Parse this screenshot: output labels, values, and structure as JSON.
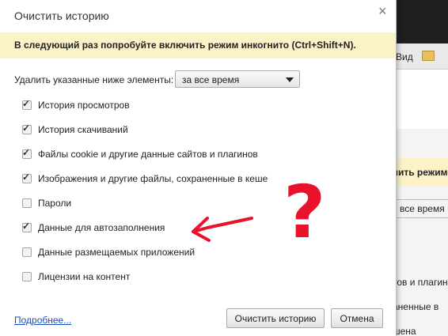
{
  "background": {
    "bookmark_text": "Вид",
    "hint_fragment": "чить режим",
    "select_fragment": "все время",
    "line1": "тов и плагин",
    "line2": "аненные в",
    "line3": "шена"
  },
  "dialog": {
    "title": "Очистить историю",
    "close_icon": "×",
    "hint": "В следующий раз попробуйте включить режим инкогнито (Ctrl+Shift+N).",
    "range_label": "Удалить указанные ниже элементы:",
    "range_value": "за все время",
    "options": [
      {
        "label": "История просмотров",
        "checked": true
      },
      {
        "label": "История скачиваний",
        "checked": true
      },
      {
        "label": "Файлы cookie и другие данные сайтов и плагинов",
        "checked": true
      },
      {
        "label": "Изображения и другие файлы, сохраненные в кеше",
        "checked": true
      },
      {
        "label": "Пароли",
        "checked": false
      },
      {
        "label": "Данные для автозаполнения",
        "checked": true
      },
      {
        "label": "Данные размещаемых приложений",
        "checked": false
      },
      {
        "label": "Лицензии на контент",
        "checked": false
      }
    ],
    "more_link": "Подробнее...",
    "clear_button": "Очистить историю",
    "cancel_button": "Отмена"
  },
  "annotation": {
    "question_mark": "?",
    "color": "#e8122d"
  }
}
